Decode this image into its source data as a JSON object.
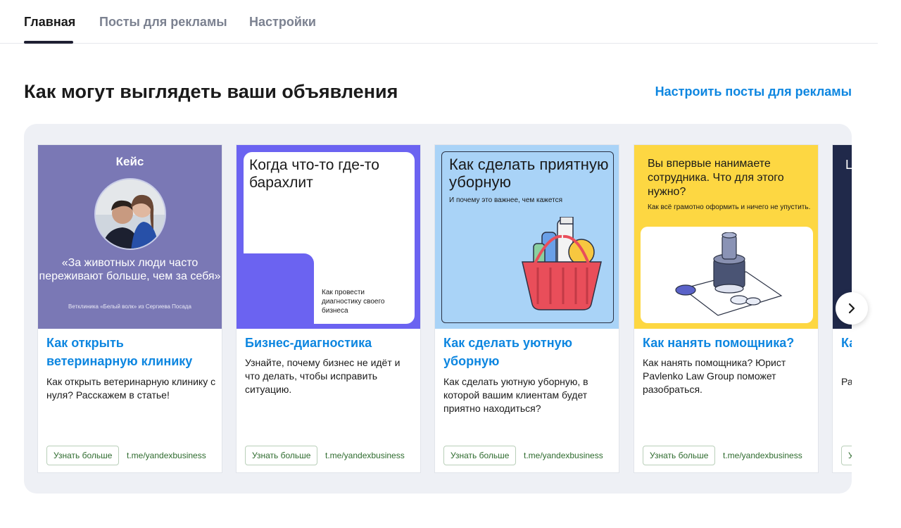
{
  "tabs": [
    {
      "label": "Главная",
      "active": true
    },
    {
      "label": "Посты для рекламы",
      "active": false
    },
    {
      "label": "Настройки",
      "active": false
    }
  ],
  "section": {
    "title": "Как могут выглядеть ваши объявления",
    "action_link": "Настроить посты для рекламы"
  },
  "cards": [
    {
      "cover": {
        "kicker": "Кейс",
        "quote": "«За животных люди часто переживают больше, чем за себя»",
        "signature": "Ветклиника «Белый волк» из Сергиева Посада"
      },
      "title": "Как открыть ветеринарную клинику",
      "text": "Как открыть ветеринарную клинику с нуля? Расскажем в статье!",
      "button": "Узнать больше",
      "link": "t.me/yandexbusiness"
    },
    {
      "cover": {
        "headline": "Когда что-то где-то барахлит",
        "sub": "Как провести диагностику своего бизнеса"
      },
      "title": "Бизнес-диагностика",
      "text": "Узнайте, почему бизнес не идёт и что делать, чтобы исправить ситуацию.",
      "button": "Узнать больше",
      "link": "t.me/yandexbusiness"
    },
    {
      "cover": {
        "headline": "Как сделать приятную уборную",
        "sub": "И почему это важнее, чем кажется"
      },
      "title": "Как сделать уютную уборную",
      "text": "Как сделать уютную уборную, в которой вашим клиентам будет приятно находиться?",
      "button": "Узнать больше",
      "link": "t.me/yandexbusiness"
    },
    {
      "cover": {
        "headline": "Вы впервые нанимаете сотрудника. Что для этого нужно?",
        "sub": "Как всё грамотно оформить и ничего не упустить."
      },
      "title": "Как нанять помощника?",
      "text": "Как нанять помощника? Юрист Pavlenko Law Group поможет разобраться.",
      "button": "Узнать больше",
      "link": "t.me/yandexbusiness"
    },
    {
      "cover": {
        "headline": "Ц Д"
      },
      "title": "Ка до",
      "text": "Ра со Сс",
      "button": "У"
    }
  ],
  "colors": {
    "accent_link": "#0d86e0",
    "cta_green": "#2e6b2e",
    "panel_bg": "#eef0f5"
  }
}
